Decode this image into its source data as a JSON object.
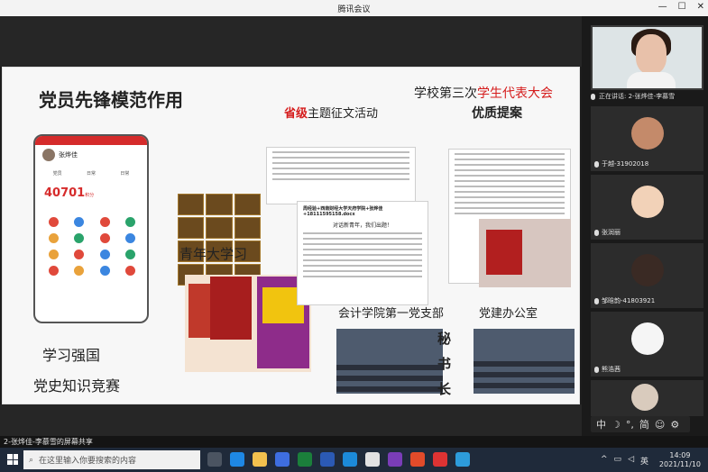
{
  "window": {
    "title": "腾讯会议"
  },
  "slide": {
    "heading_left": "党员先锋模范作用",
    "heading_mid_red": "省级",
    "heading_mid_rest": "主题征文活动",
    "heading_right_1a": "学校第三次",
    "heading_right_1b": "学生代表大会",
    "heading_right_2": "优质提案",
    "label_youth": "青年大学习",
    "label_study": "学习强国",
    "label_quiz": "党史知识竞赛",
    "label_branch": "会计学院第一党支部",
    "label_office": "党建办公室",
    "vertical": [
      "秘",
      "书",
      "长"
    ],
    "phone": {
      "name": "张烨佳",
      "tabs": [
        "党员",
        "日常",
        "日常"
      ],
      "score": "40701",
      "score_unit": "积分"
    },
    "doc_title": "周经验+西南财经大学天府学院+张烨佳+18111595158.docx",
    "doc_heading": "对话新青年，我们出题！"
  },
  "participants": [
    {
      "name": "正在讲话: 2-张烨佳-李慕雪",
      "role": "speaker"
    },
    {
      "name": "于越-31902018",
      "color": "#c48a6a"
    },
    {
      "name": "张润丽",
      "color": "#f2d2b8"
    },
    {
      "name": "邹晗韵-41803921",
      "color": "#3a2a24"
    },
    {
      "name": "熊浩茜",
      "color": "#f5f5f5"
    },
    {
      "name": "",
      "color": "#d9cbbd"
    }
  ],
  "share_bar": {
    "text": "2-张烨佳-李慕雪的屏幕共享"
  },
  "ime": {
    "items": [
      "中",
      "☽",
      "°,",
      "简",
      "☺",
      "⚙"
    ]
  },
  "taskbar": {
    "search_placeholder": "在这里输入你要搜索的内容",
    "time": "14:09",
    "date": "2021/11/10",
    "tray_lang": "英"
  }
}
